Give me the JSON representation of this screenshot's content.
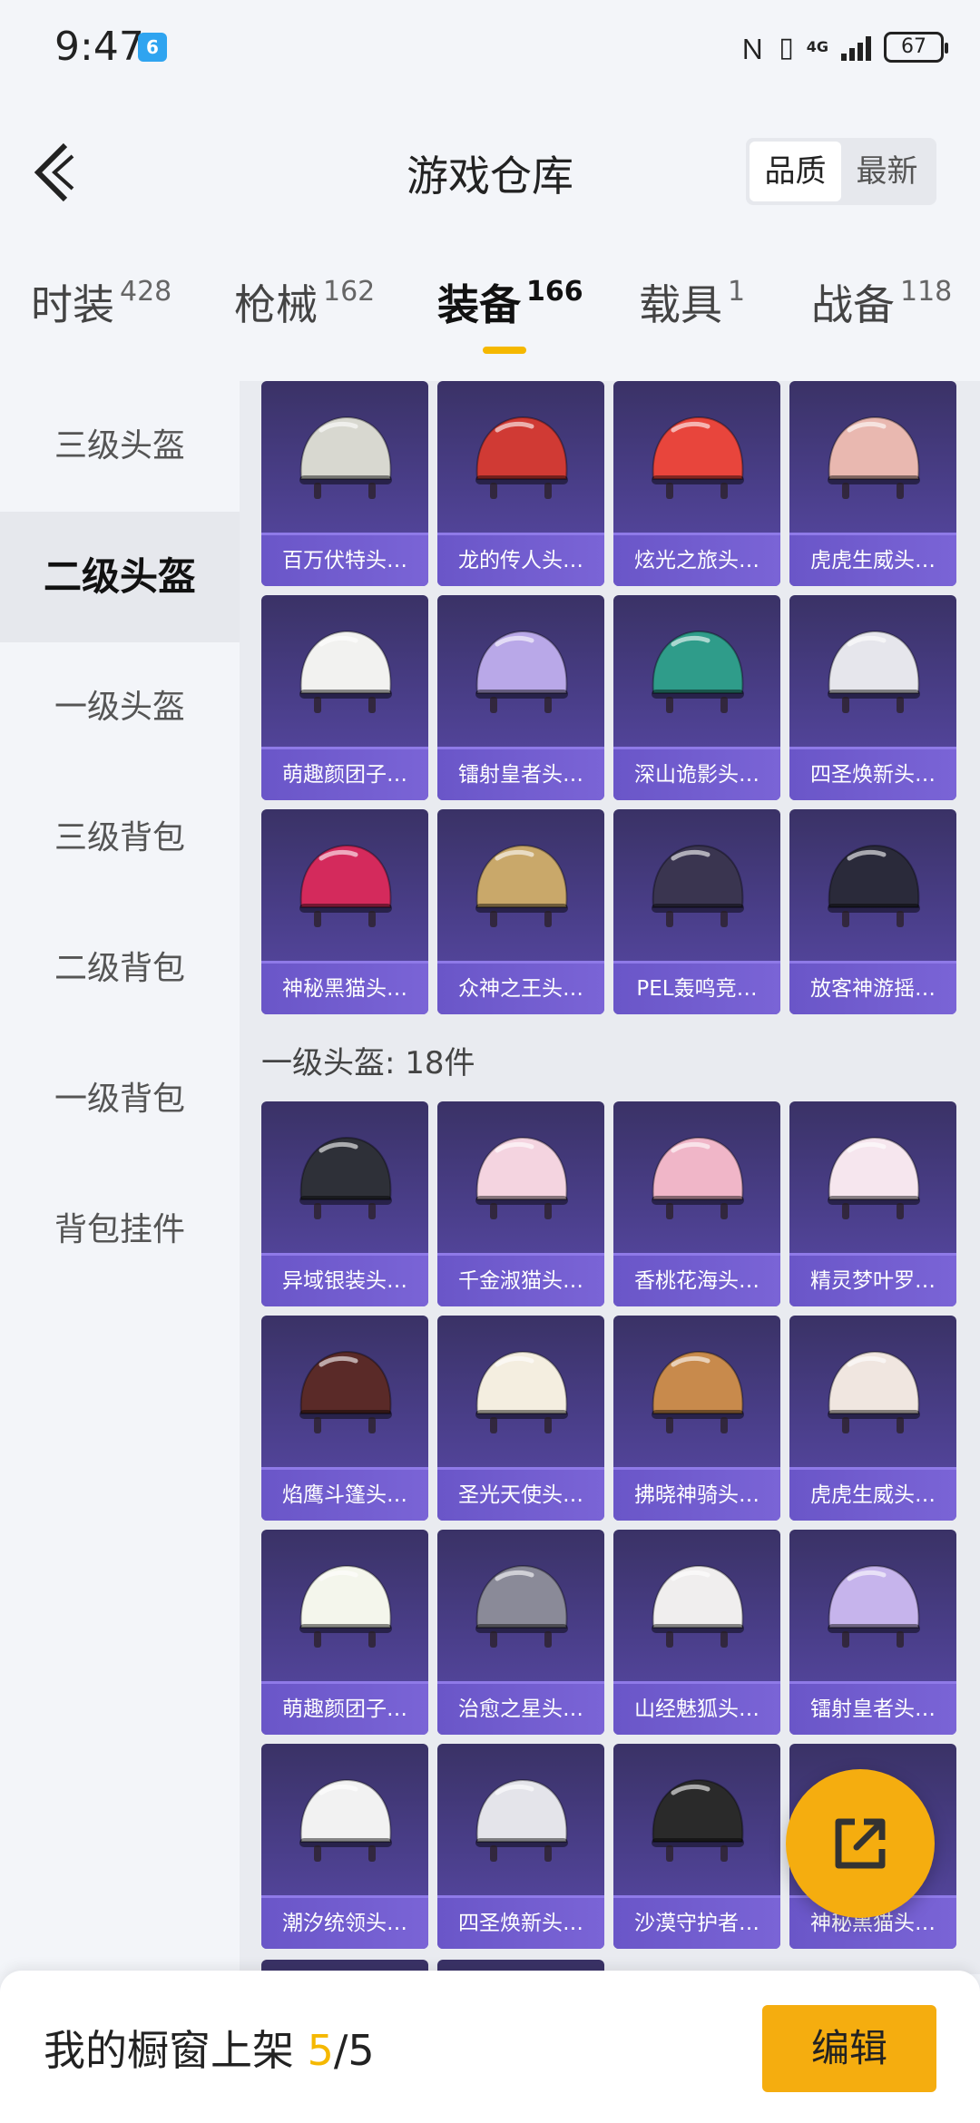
{
  "status_bar": {
    "time": "9:47",
    "app_badge": "6",
    "network": "4G",
    "battery": "67",
    "icons": [
      "nfc-icon",
      "vibrate-icon",
      "signal-icon",
      "battery-icon"
    ]
  },
  "header": {
    "title": "游戏仓库",
    "sort_options": [
      "品质",
      "最新"
    ],
    "active_sort": "品质"
  },
  "tabs": [
    {
      "label": "时装",
      "count": "428"
    },
    {
      "label": "枪械",
      "count": "162"
    },
    {
      "label": "装备",
      "count": "166",
      "active": true
    },
    {
      "label": "载具",
      "count": "1"
    },
    {
      "label": "战备",
      "count": "118"
    }
  ],
  "sidebar": {
    "items": [
      "三级头盔",
      "二级头盔",
      "一级头盔",
      "三级背包",
      "二级背包",
      "一级背包",
      "背包挂件"
    ],
    "active": "二级头盔"
  },
  "level2_items": [
    {
      "name": "百万伏特头…",
      "color": "#d8d8d0"
    },
    {
      "name": "龙的传人头…",
      "color": "#d03a34"
    },
    {
      "name": "炫光之旅头…",
      "color": "#e8453c"
    },
    {
      "name": "虎虎生威头…",
      "color": "#e9b8b0"
    },
    {
      "name": "萌趣颜团子…",
      "color": "#f2f2f0"
    },
    {
      "name": "镭射皇者头…",
      "color": "#b9a8e8"
    },
    {
      "name": "深山诡影头…",
      "color": "#2f9c8a"
    },
    {
      "name": "四圣焕新头…",
      "color": "#e6e6ec"
    },
    {
      "name": "神秘黑猫头…",
      "color": "#d42a5c"
    },
    {
      "name": "众神之王头…",
      "color": "#c9a86a"
    },
    {
      "name": "PEL轰鸣竞…",
      "color": "#3a3550"
    },
    {
      "name": "放客神游摇…",
      "color": "#2a2a3a"
    }
  ],
  "level1_section": {
    "label": "一级头盔: 18件",
    "items": [
      {
        "name": "异域银装头…",
        "color": "#2e3038"
      },
      {
        "name": "千金淑猫头…",
        "color": "#f4d4e0"
      },
      {
        "name": "香桃花海头…",
        "color": "#f0b6c8"
      },
      {
        "name": "精灵梦叶罗…",
        "color": "#f6e6ee"
      },
      {
        "name": "焰鹰斗篷头…",
        "color": "#5a2a28"
      },
      {
        "name": "圣光天使头…",
        "color": "#f4eee0"
      },
      {
        "name": "拂晓神骑头…",
        "color": "#c88a4c"
      },
      {
        "name": "虎虎生威头…",
        "color": "#f0e6e0"
      },
      {
        "name": "萌趣颜团子…",
        "color": "#f4f6ec"
      },
      {
        "name": "治愈之星头…",
        "color": "#8a8a98"
      },
      {
        "name": "山经魅狐头…",
        "color": "#f0eeee"
      },
      {
        "name": "镭射皇者头…",
        "color": "#c6b4ec"
      },
      {
        "name": "潮汐统领头…",
        "color": "#f2f2f2"
      },
      {
        "name": "四圣焕新头…",
        "color": "#e4e4ea"
      },
      {
        "name": "沙漠守护者…",
        "color": "#2a2a2a"
      },
      {
        "name": "神秘黑猫头…",
        "color": "#3a3a48"
      }
    ]
  },
  "bottom_bar": {
    "shelf_label": "我的橱窗上架",
    "shelf_current": "5",
    "shelf_total": "/5",
    "edit_label": "编辑"
  },
  "colors": {
    "accent": "#f5ad0f",
    "card_top": "#3a3266",
    "card_bottom": "#5a4aa8"
  }
}
